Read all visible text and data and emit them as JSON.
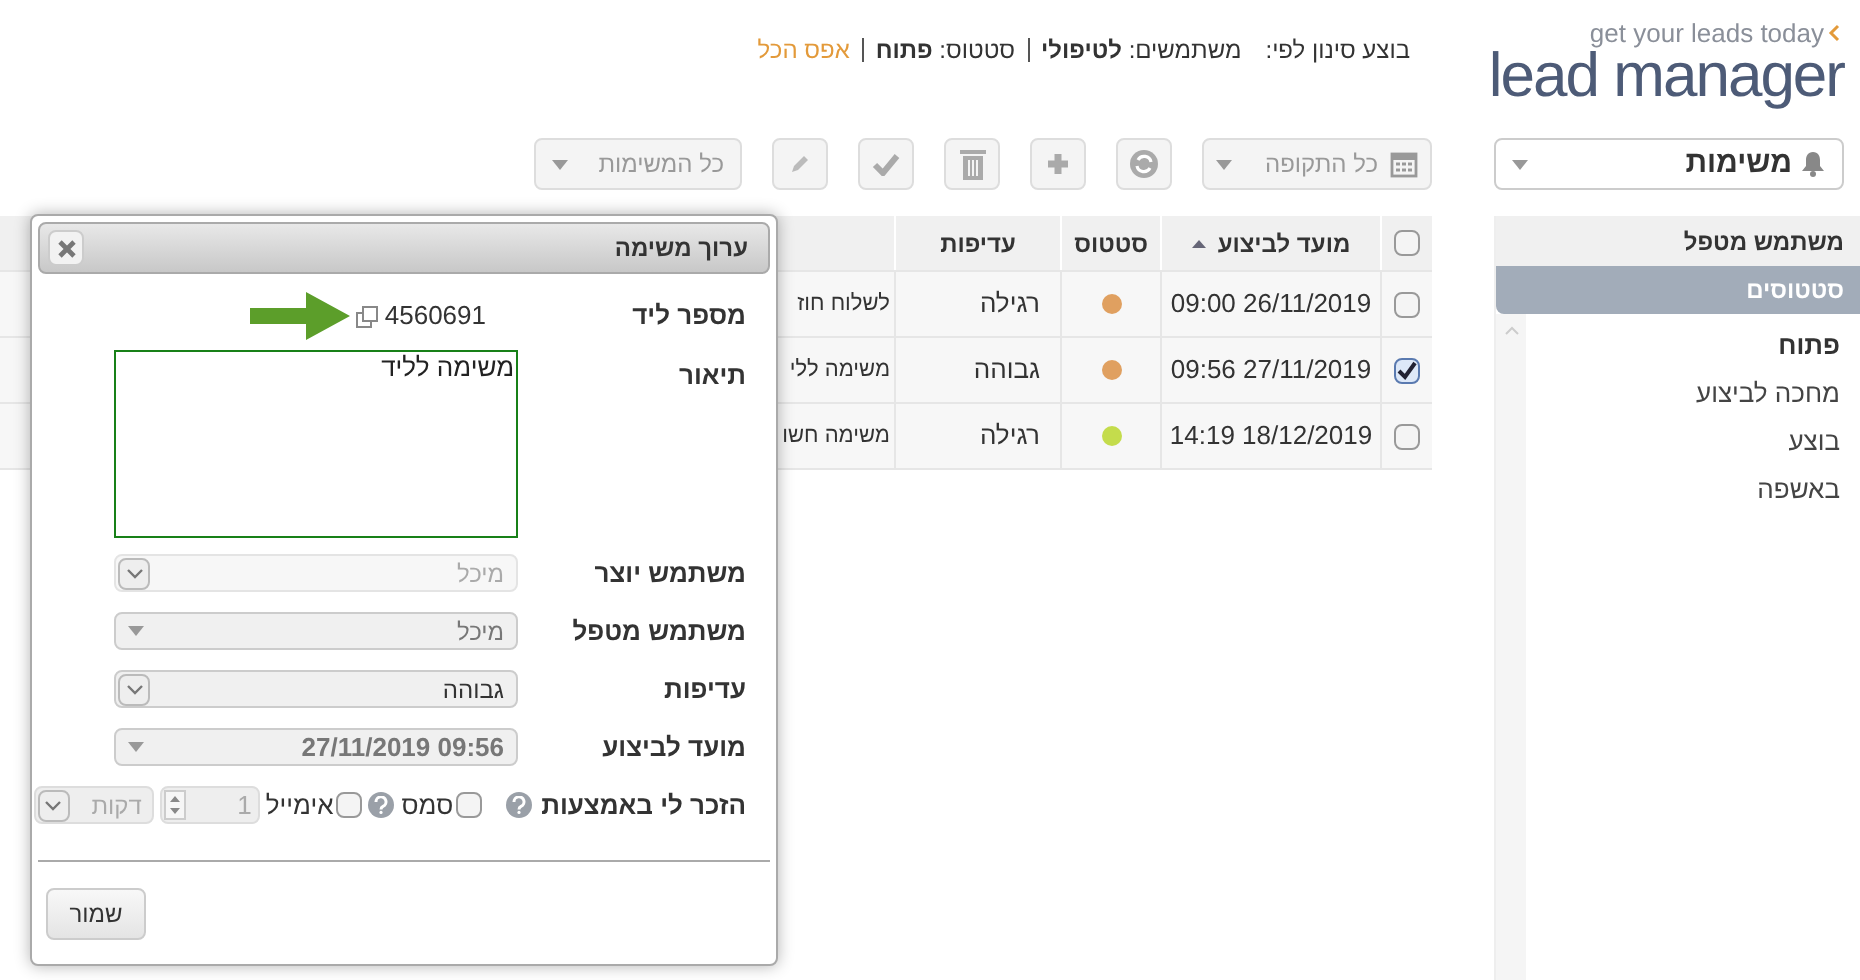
{
  "logo": {
    "tagline": "get your leads today",
    "name": "lead manager"
  },
  "filter_summary": {
    "prefix": "בוצע סינון לפי:",
    "users_label": "משתמשים:",
    "users_value": "לטיפולי",
    "status_label": "סטטוס:",
    "status_value": "פתוח",
    "reset_link": "אפס הכל"
  },
  "module_dropdown": {
    "value": "משימות"
  },
  "toolbar": {
    "period_dropdown": "כל התקופה",
    "tasks_dropdown": "כל המשימות"
  },
  "sidebar": {
    "header": "משתמש מטפל",
    "section": "סטטוסים",
    "items": [
      {
        "label": "פתוח",
        "selected": true
      },
      {
        "label": "מחכה לביצוע",
        "selected": false
      },
      {
        "label": "בוצע",
        "selected": false
      },
      {
        "label": "באשפה",
        "selected": false
      }
    ]
  },
  "table": {
    "header_checked": false,
    "columns": [
      {
        "label": "מועד לביצוע",
        "sorted": true
      },
      {
        "label": "סטטוס",
        "sorted": false
      },
      {
        "label": "עדיפות",
        "sorted": false
      }
    ],
    "rows": [
      {
        "checked": false,
        "due": "09:00 26/11/2019",
        "color": "#e0a060",
        "priority": "רגילה",
        "description": "לשלוח חוז"
      },
      {
        "checked": true,
        "due": "09:56 27/11/2019",
        "color": "#e0a060",
        "priority": "גבוהה",
        "description": "משימה ללי"
      },
      {
        "checked": false,
        "due": "14:19 18/12/2019",
        "color": "#c4dc4c",
        "priority": "רגילה",
        "description": "משימה חשו"
      }
    ]
  },
  "dialog": {
    "title": "ערוך משימה",
    "lead_number": {
      "label": "מספר ליד",
      "value": "4560691"
    },
    "description": {
      "label": "תיאור",
      "value": "משימה לליד"
    },
    "creator": {
      "label": "משתמש יוצר",
      "value": "מיכל",
      "disabled": true
    },
    "assignee": {
      "label": "משתמש מטפל",
      "value": "מיכל"
    },
    "priority": {
      "label": "עדיפות",
      "value": "גבוהה"
    },
    "due": {
      "label": "מועד לביצוע",
      "value": "27/11/2019 09:56"
    },
    "remind": {
      "label": "הזכר לי באמצעות",
      "sms": {
        "label": "סמס",
        "checked": false
      },
      "email": {
        "label": "אימייל",
        "checked": false
      },
      "amount": "1",
      "unit": "דקות"
    },
    "save_button": "שמור"
  }
}
